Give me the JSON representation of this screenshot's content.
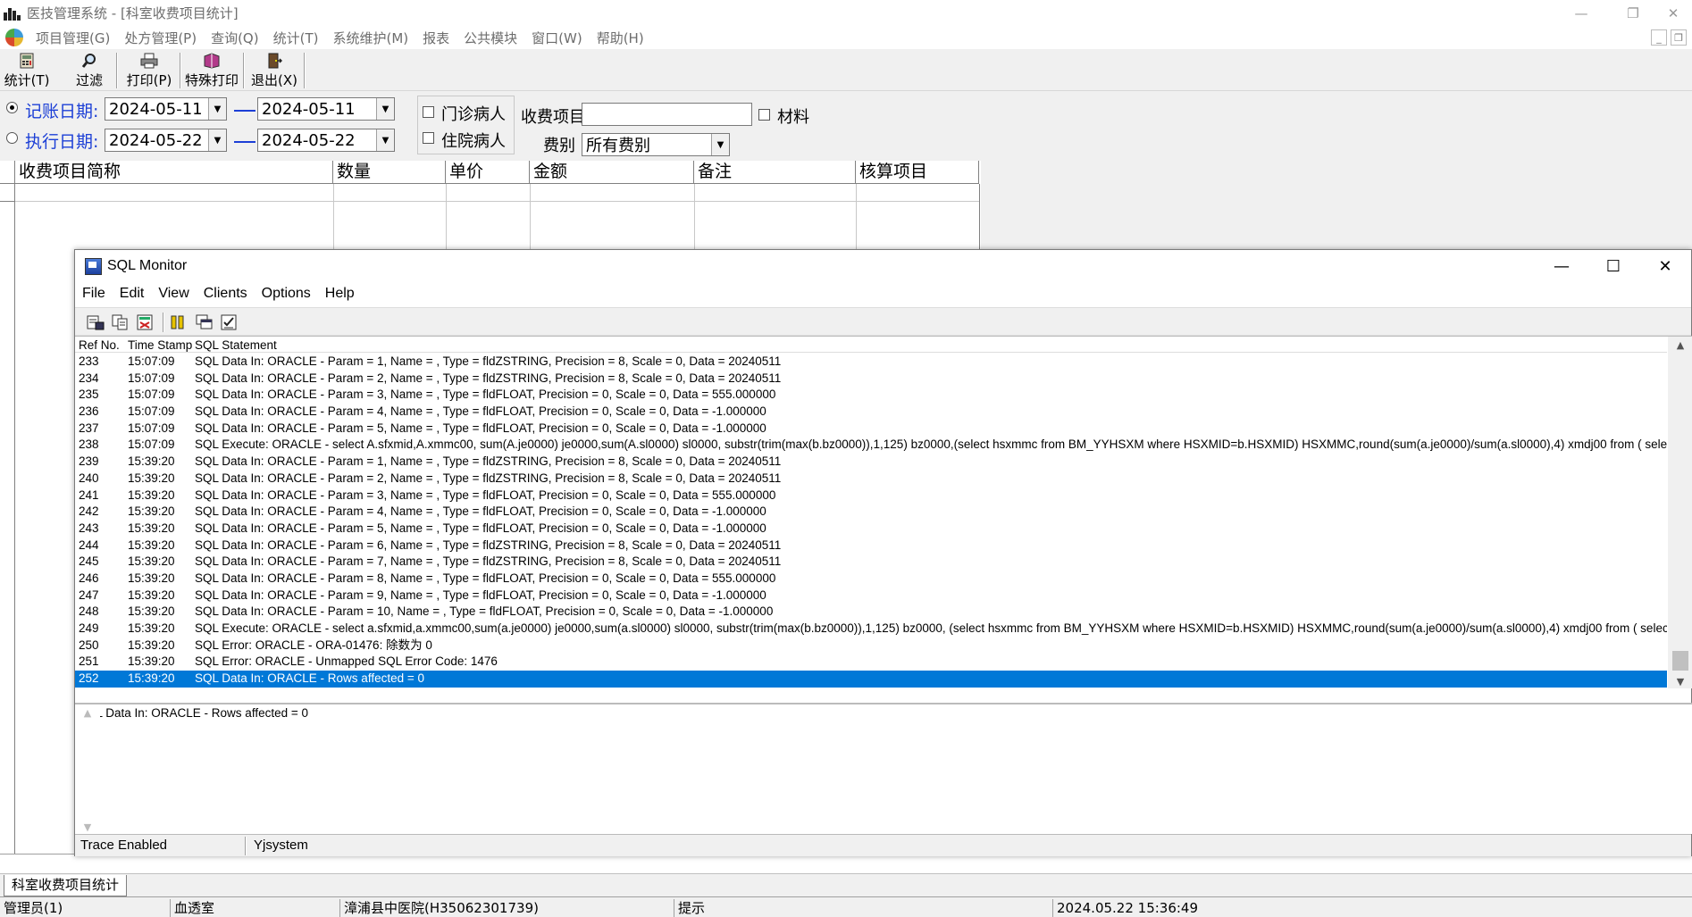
{
  "app": {
    "title": "医技管理系统 - [科室收费项目统计]",
    "menu": [
      "项目管理(G)",
      "处方管理(P)",
      "查询(Q)",
      "统计(T)",
      "系统维护(M)",
      "报表",
      "公共模块",
      "窗口(W)",
      "帮助(H)"
    ],
    "toolbar": {
      "stats": "统计(T)",
      "filter": "过滤",
      "print": "打印(P)",
      "special_print": "特殊打印",
      "exit": "退出(X)"
    }
  },
  "filter": {
    "billing_date_label": "记账日期:",
    "billing_date_from": "2024-05-11",
    "billing_date_to": "2024-05-11",
    "exec_date_label": "执行日期:",
    "exec_date_from": "2024-05-22",
    "exec_date_to": "2024-05-22",
    "selected_date_mode": "billing",
    "outpatient_label": "门诊病人",
    "inpatient_label": "住院病人",
    "charge_item_label": "收费项目",
    "charge_item_value": "",
    "material_label": "材料",
    "fee_type_label": "费别",
    "fee_type_value": "所有费别"
  },
  "grid": {
    "columns": [
      "收费项目简称",
      "数量",
      "单价",
      "金额",
      "备注",
      "核算项目"
    ]
  },
  "tabs": [
    "科室收费项目统计"
  ],
  "status": {
    "user": "管理员(1)",
    "dept": "血透室",
    "hospital": "漳浦县中医院(H35062301739)",
    "hint": "提示",
    "datetime": "2024.05.22 15:36:49"
  },
  "sql_monitor": {
    "title": "SQL Monitor",
    "menu": [
      "File",
      "Edit",
      "View",
      "Clients",
      "Options",
      "Help"
    ],
    "columns": {
      "ref": "Ref No.",
      "time": "Time Stamp",
      "stmt": "SQL Statement"
    },
    "rows": [
      {
        "ref": "233",
        "time": "15:07:09",
        "stmt": "SQL Data In: ORACLE - Param = 1, Name = , Type = fldZSTRING, Precision = 8, Scale = 0, Data = 20240511"
      },
      {
        "ref": "234",
        "time": "15:07:09",
        "stmt": "SQL Data In: ORACLE - Param = 2, Name = , Type = fldZSTRING, Precision = 8, Scale = 0, Data = 20240511"
      },
      {
        "ref": "235",
        "time": "15:07:09",
        "stmt": "SQL Data In: ORACLE - Param = 3, Name = , Type = fldFLOAT, Precision = 0, Scale = 0, Data = 555.000000"
      },
      {
        "ref": "236",
        "time": "15:07:09",
        "stmt": "SQL Data In: ORACLE - Param = 4, Name = , Type = fldFLOAT, Precision = 0, Scale = 0, Data = -1.000000"
      },
      {
        "ref": "237",
        "time": "15:07:09",
        "stmt": "SQL Data In: ORACLE - Param = 5, Name = , Type = fldFLOAT, Precision = 0, Scale = 0, Data = -1.000000"
      },
      {
        "ref": "238",
        "time": "15:07:09",
        "stmt": "SQL Execute: ORACLE - select A.sfxmid,A.xmmc00, sum(A.je0000) je0000,sum(A.sl0000) sl0000, substr(trim(max(b.bz0000)),1,125) bz0000,(select hsxmmc from BM_YYHSXM where HSXMID=b.HSXMID) HSXMMC,round(sum(a.je0000)/sum(a.sl0000),4) xmdj00 from ( select sum(hj"
      },
      {
        "ref": "239",
        "time": "15:39:20",
        "stmt": "SQL Data In: ORACLE - Param = 1, Name = , Type = fldZSTRING, Precision = 8, Scale = 0, Data = 20240511"
      },
      {
        "ref": "240",
        "time": "15:39:20",
        "stmt": "SQL Data In: ORACLE - Param = 2, Name = , Type = fldZSTRING, Precision = 8, Scale = 0, Data = 20240511"
      },
      {
        "ref": "241",
        "time": "15:39:20",
        "stmt": "SQL Data In: ORACLE - Param = 3, Name = , Type = fldFLOAT, Precision = 0, Scale = 0, Data = 555.000000"
      },
      {
        "ref": "242",
        "time": "15:39:20",
        "stmt": "SQL Data In: ORACLE - Param = 4, Name = , Type = fldFLOAT, Precision = 0, Scale = 0, Data = -1.000000"
      },
      {
        "ref": "243",
        "time": "15:39:20",
        "stmt": "SQL Data In: ORACLE - Param = 5, Name = , Type = fldFLOAT, Precision = 0, Scale = 0, Data = -1.000000"
      },
      {
        "ref": "244",
        "time": "15:39:20",
        "stmt": "SQL Data In: ORACLE - Param = 6, Name = , Type = fldZSTRING, Precision = 8, Scale = 0, Data = 20240511"
      },
      {
        "ref": "245",
        "time": "15:39:20",
        "stmt": "SQL Data In: ORACLE - Param = 7, Name = , Type = fldZSTRING, Precision = 8, Scale = 0, Data = 20240511"
      },
      {
        "ref": "246",
        "time": "15:39:20",
        "stmt": "SQL Data In: ORACLE - Param = 8, Name = , Type = fldFLOAT, Precision = 0, Scale = 0, Data = 555.000000"
      },
      {
        "ref": "247",
        "time": "15:39:20",
        "stmt": "SQL Data In: ORACLE - Param = 9, Name = , Type = fldFLOAT, Precision = 0, Scale = 0, Data = -1.000000"
      },
      {
        "ref": "248",
        "time": "15:39:20",
        "stmt": "SQL Data In: ORACLE - Param = 10, Name = , Type = fldFLOAT, Precision = 0, Scale = 0, Data = -1.000000"
      },
      {
        "ref": "249",
        "time": "15:39:20",
        "stmt": "SQL Execute: ORACLE - select a.sfxmid,a.xmmc00,sum(a.je0000) je0000,sum(a.sl0000) sl0000, substr(trim(max(b.bz0000)),1,125) bz0000,  (select hsxmmc from BM_YYHSXM where HSXMID=b.HSXMID) HSXMMC,round(sum(a.je0000)/sum(a.sl0000),4) xmdj00 from (  select sum(h"
      },
      {
        "ref": "250",
        "time": "15:39:20",
        "stmt": "SQL Error: ORACLE - ORA-01476: 除数为 0"
      },
      {
        "ref": "251",
        "time": "15:39:20",
        "stmt": "SQL Error: ORACLE - Unmapped SQL Error Code: 1476"
      },
      {
        "ref": "252",
        "time": "15:39:20",
        "stmt": "SQL Data In: ORACLE - Rows affected = 0"
      }
    ],
    "selected_ref": "252",
    "detail_text": "SQL Data In: ORACLE - Rows affected = 0",
    "status_left": "Trace Enabled",
    "status_right": "Yjsystem"
  }
}
